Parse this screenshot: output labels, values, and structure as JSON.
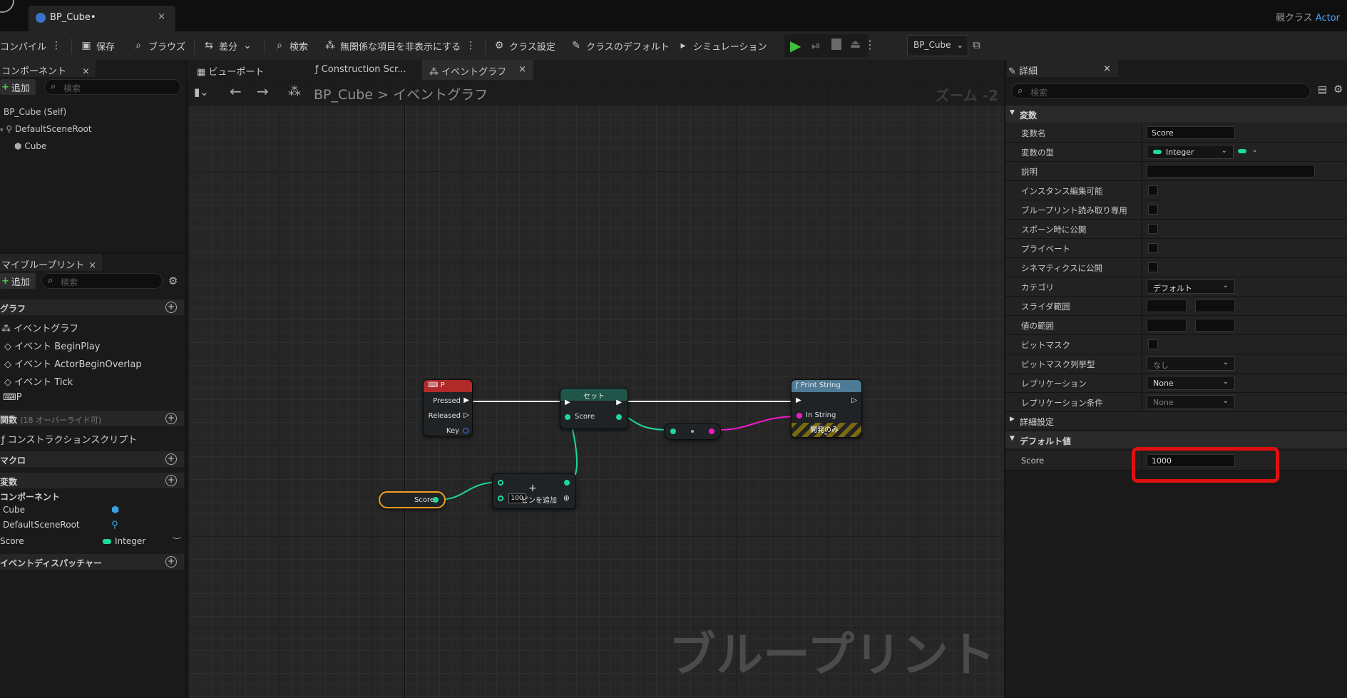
{
  "titlebar": {
    "tab_label": "BP_Cube•",
    "tab_close": "×",
    "parent_class_label": "親クラス",
    "parent_class_value": "Actor"
  },
  "toolbar": {
    "compile": "コンパイル",
    "save": "保存",
    "browse": "ブラウズ",
    "diff": "差分",
    "search": "検索",
    "hide_unrelated": "無関係な項目を非表示にする",
    "class_settings": "クラス設定",
    "class_defaults": "クラスのデフォルト",
    "simulation": "シミュレーション",
    "debug_object": "BP_Cube"
  },
  "components": {
    "tab_label": "コンポーネント",
    "add_label": "追加",
    "search_placeholder": "検索",
    "tree": [
      "BP_Cube (Self)",
      "DefaultSceneRoot",
      "Cube"
    ]
  },
  "my_blueprint": {
    "tab_label": "マイブループリント",
    "add_label": "追加",
    "search_placeholder": "検索",
    "graphs_header": "グラフ",
    "graph_items": [
      "イベントグラフ",
      "イベント BeginPlay",
      "イベント ActorBeginOverlap",
      "イベント Tick",
      "P"
    ],
    "functions_header": "関数",
    "functions_note": "(18 オーバーライド可)",
    "construction_script": "コンストラクションスクリプト",
    "macros_header": "マクロ",
    "variables_header": "変数",
    "components_header": "コンポーネント",
    "component_vars": [
      "Cube",
      "DefaultSceneRoot"
    ],
    "score_var_name": "Score",
    "score_var_type": "Integer",
    "dispatchers_header": "イベントディスパッチャー"
  },
  "graph_tabs": {
    "viewport": "ビューポート",
    "construction": "Construction Scr...",
    "event_graph": "イベントグラフ",
    "close": "×"
  },
  "graph": {
    "breadcrumb_root": "BP_Cube",
    "breadcrumb_sep": ">",
    "breadcrumb_current": "イベントグラフ",
    "zoom": "ズーム -2",
    "watermark": "ブループリント",
    "nodes": {
      "key_event": {
        "title": "P",
        "pins": [
          "Pressed",
          "Released",
          "Key"
        ]
      },
      "set": {
        "title": "セット",
        "pin": "Score"
      },
      "print": {
        "title": "Print String",
        "pin": "In String",
        "dev_only": "開発のみ"
      },
      "get": {
        "label": "Score"
      },
      "add": {
        "literal": "100",
        "add_pin": "ピンを追加"
      }
    },
    "colors": {
      "exec": "#e8e8e8",
      "integer": "#1fd8a0",
      "string": "#f019c8"
    }
  },
  "details": {
    "tab_label": "詳細",
    "search_placeholder": "検索",
    "variable_section": "変数",
    "rows": {
      "var_name_label": "変数名",
      "var_name_value": "Score",
      "var_type_label": "変数の型",
      "var_type_value": "Integer",
      "desc_label": "説明",
      "instance_editable": "インスタンス編集可能",
      "bp_readonly": "ブループリント読み取り専用",
      "expose_spawn": "スポーン時に公開",
      "private": "プライベート",
      "expose_cinematics": "シネマティクスに公開",
      "category_label": "カテゴリ",
      "category_value": "デフォルト",
      "slider_range": "スライダ範囲",
      "value_range": "値の範囲",
      "bitmask": "ビットマスク",
      "bitmask_enum_label": "ビットマスク列挙型",
      "bitmask_enum_value": "なし",
      "replication_label": "レプリケーション",
      "replication_value": "None",
      "rep_condition_label": "レプリケーション条件",
      "rep_condition_value": "None"
    },
    "advanced_section": "詳細設定",
    "default_section": "デフォルト値",
    "default_score_label": "Score",
    "default_score_value": "1000"
  }
}
